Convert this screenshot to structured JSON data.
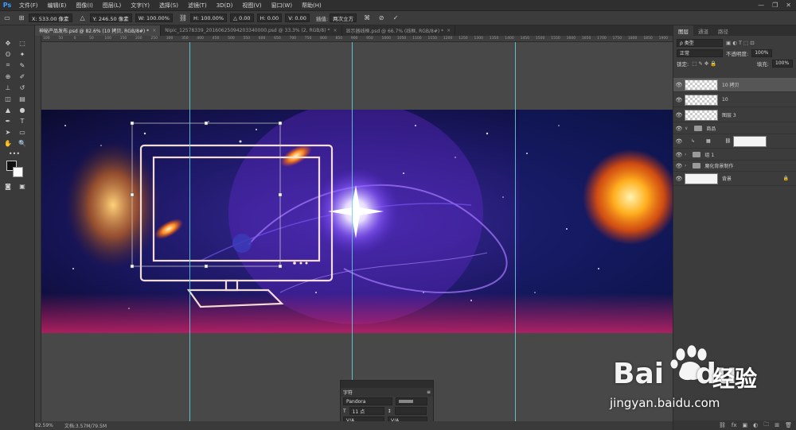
{
  "app": {
    "logo": "Ps"
  },
  "menu": [
    "文件(F)",
    "编辑(E)",
    "图像(I)",
    "图层(L)",
    "文字(Y)",
    "选择(S)",
    "滤镜(T)",
    "3D(D)",
    "视图(V)",
    "窗口(W)",
    "帮助(H)"
  ],
  "window_controls": [
    "—",
    "❐",
    "✕"
  ],
  "options": {
    "x": "X: 533.00 像素",
    "y": "Y: 246.50 像素",
    "w": "W: 100.00%",
    "h": "H: 100.00%",
    "angle": "△ 0.00",
    "hskew": "H: 0.00",
    "vskew": "V: 0.00",
    "interp_label": "插值:",
    "interp_value": "两次立方"
  },
  "tabs": [
    {
      "label": "神秘产品发布.psd @ 82.6% (10 拷贝, RGB/8#) *",
      "active": true
    },
    {
      "label": "Nipic_12578339_20160625094203340000.psd @ 33.3% (2, RGB/8) *",
      "active": false
    },
    {
      "label": "显示器线框.psd @ 66.7% (线框, RGB/8#) *",
      "active": false
    }
  ],
  "ruler_ticks": [
    "100",
    "50",
    "0",
    "50",
    "100",
    "150",
    "200",
    "250",
    "300",
    "350",
    "400",
    "450",
    "500",
    "550",
    "600",
    "650",
    "700",
    "750",
    "800",
    "850",
    "900",
    "950",
    "1000",
    "1050",
    "1100",
    "1150",
    "1200",
    "1250",
    "1300",
    "1350",
    "1400",
    "1450",
    "1500",
    "1550",
    "1600",
    "1650",
    "1700",
    "1750",
    "1800",
    "1850",
    "1900"
  ],
  "status": {
    "zoom": "82.59%",
    "doc": "文档:3.57M/79.5M"
  },
  "panel": {
    "tabs": [
      "图层",
      "通道",
      "路径"
    ],
    "filter": "ρ 类型",
    "blend_mode": "正常",
    "opacity_label": "不透明度:",
    "opacity": "100%",
    "lock_label": "锁定:",
    "fill_label": "填充:",
    "fill": "100%",
    "layers": [
      {
        "name": "10 拷贝",
        "kind": "thumb",
        "selected": true
      },
      {
        "name": "10",
        "kind": "thumb",
        "selected": false
      },
      {
        "name": "图层 3",
        "kind": "thumb",
        "selected": false
      },
      {
        "name": "商品",
        "kind": "folder",
        "selected": false
      },
      {
        "name": "",
        "kind": "smart",
        "selected": false
      },
      {
        "name": "组 1",
        "kind": "folder",
        "selected": false
      },
      {
        "name": "魔化背景制作",
        "kind": "folder",
        "selected": false
      },
      {
        "name": "背景",
        "kind": "white",
        "selected": false
      }
    ],
    "bottom_icons": [
      "fx",
      "◐",
      "▣",
      "▭",
      "🗀",
      "⊞",
      "🗑"
    ]
  },
  "char_panel": {
    "title": "字符",
    "font": "Pandora",
    "size": "11 点",
    "leading": "",
    "kerning": "V/A",
    "tracking": "V/A"
  },
  "watermark": {
    "brand": "Bai",
    "brand2": "du",
    "cn": "经验",
    "url": "jingyan.baidu.com"
  }
}
